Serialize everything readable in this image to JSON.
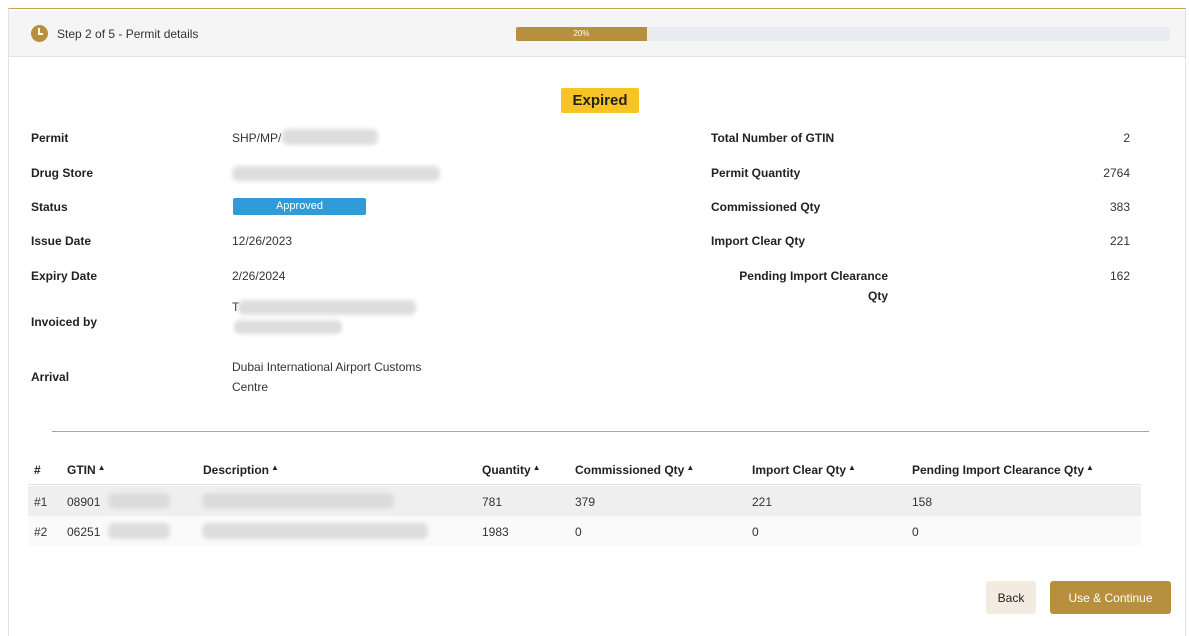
{
  "step": {
    "label": "Step 2 of 5 - Permit details",
    "progress_text": "20%",
    "progress_fraction": 0.2
  },
  "badge": "Expired",
  "details_left": [
    {
      "label": "Permit",
      "value": "SHP/MP/"
    },
    {
      "label": "Drug Store",
      "value": ""
    },
    {
      "label": "Status",
      "value": "Approved"
    },
    {
      "label": "Issue Date",
      "value": "12/26/2023"
    },
    {
      "label": "Expiry Date",
      "value": "2/26/2024"
    },
    {
      "label": "Invoiced by",
      "value": "T"
    },
    {
      "label": "Arrival",
      "value_line1": "Dubai International Airport Customs",
      "value_line2": "Centre"
    }
  ],
  "details_right": [
    {
      "label": "Total Number of GTIN",
      "value": "2"
    },
    {
      "label": "Permit Quantity",
      "value": "2764"
    },
    {
      "label": "Commissioned Qty",
      "value": "383"
    },
    {
      "label": "Import Clear Qty",
      "value": "221"
    },
    {
      "label_line1": "Pending Import Clearance",
      "label_line2": "Qty",
      "value": "162"
    }
  ],
  "table": {
    "headers": [
      "#",
      "GTIN",
      "Description",
      "Quantity",
      "Commissioned Qty",
      "Import Clear Qty",
      "Pending Import Clearance Qty"
    ],
    "rows": [
      {
        "num": "#1",
        "gtin": "08901",
        "description": "",
        "quantity": "781",
        "commissioned": "379",
        "import_clear": "221",
        "pending": "158"
      },
      {
        "num": "#2",
        "gtin": "06251",
        "description": "",
        "quantity": "1983",
        "commissioned": "0",
        "import_clear": "0",
        "pending": "0"
      }
    ],
    "sort_icon": "caret-up-icon"
  },
  "buttons": {
    "back": "Back",
    "continue": "Use & Continue"
  },
  "colors": {
    "accent": "#b8903d",
    "expired_badge": "#f7c325",
    "status_approved": "#2f9bd8"
  }
}
